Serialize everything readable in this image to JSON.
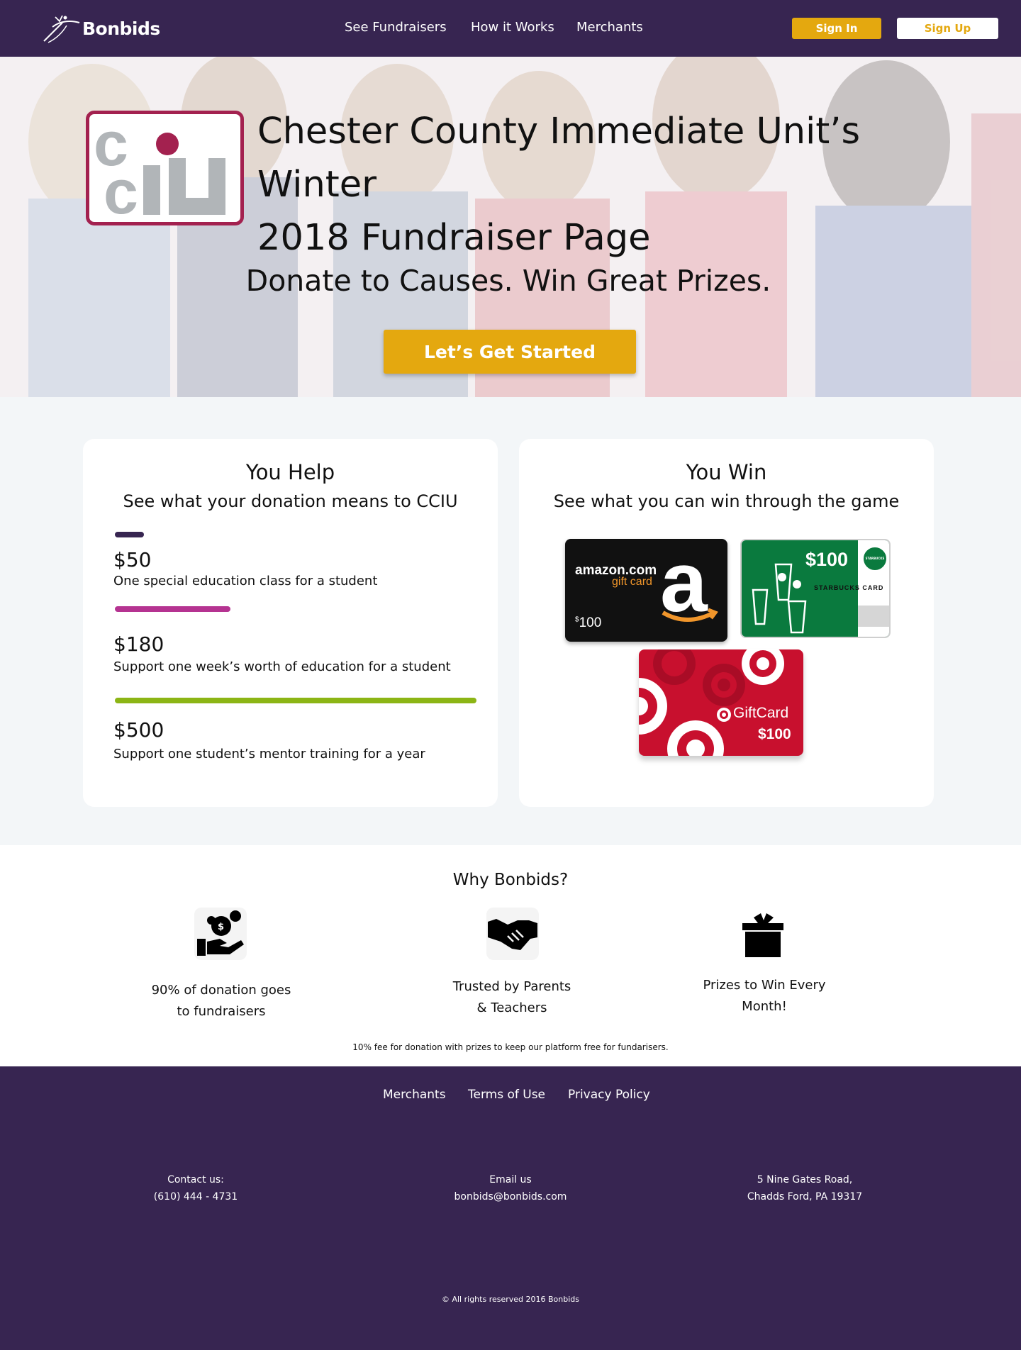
{
  "nav": {
    "brand": "Bonbids",
    "links": [
      "See Fundraisers",
      "How it Works",
      "Merchants"
    ],
    "sign_in": "Sign In",
    "sign_up": "Sign Up"
  },
  "hero": {
    "logo_text": "cciu",
    "title_line1": "Chester County Immediate Unit’s Winter",
    "title_line2": "2018 Fundraiser Page",
    "tagline": "Donate to Causes. Win Great Prizes.",
    "cta": "Let’s Get Started"
  },
  "help": {
    "title": "You Help",
    "subtitle": "See what your donation means to CCIU",
    "tiers": [
      {
        "amount": "$50",
        "description": "One special education class for a student",
        "level": 0.08,
        "color": "#372551"
      },
      {
        "amount": "$180",
        "description": "Support one week’s worth of education for a student",
        "level": 0.32,
        "color": "#b53391"
      },
      {
        "amount": "$500",
        "description": "Support one student’s mentor training for a year",
        "level": 1.0,
        "color": "#8cb515"
      }
    ]
  },
  "win": {
    "title": "You Win",
    "subtitle": "See what you can win through the game",
    "prizes": {
      "amazon": {
        "brand": "amazon.com",
        "kind": "gift card",
        "value": "100",
        "currency": "$"
      },
      "starbucks": {
        "value": "$100",
        "label": "STARBUCKS CARD",
        "seal": "STARBUCKS COFFEE"
      },
      "target": {
        "label": "GiftCard",
        "value": "$100"
      }
    }
  },
  "why": {
    "title": "Why Bonbids?",
    "items": [
      {
        "line1": "90% of donation goes",
        "line2": "to fundraisers",
        "icon": "donation-hand-icon"
      },
      {
        "line1": "Trusted by Parents",
        "line2": "& Teachers",
        "icon": "handshake-icon"
      },
      {
        "line1": "Prizes to Win Every",
        "line2": "Month!",
        "icon": "gift-box-icon"
      }
    ],
    "note": "10% fee for donation with prizes to keep our platform free for fundarisers."
  },
  "footer": {
    "links": [
      "Merchants",
      "Terms of Use",
      "Privacy Policy"
    ],
    "contact_label": "Contact us:",
    "contact_phone": "(610) 444 - 4731",
    "email_label": "Email us",
    "email": "bonbids@bonbids.com",
    "address_line1": "5 Nine Gates Road,",
    "address_line2": "Chadds Ford, PA 19317",
    "copyright": "© All rights reserved 2016 Bonbids"
  },
  "colors": {
    "nav_bg": "#372551",
    "accent_gold": "#e4a80f",
    "cciu_red": "#a3214f",
    "section_bg": "#f3f6f8"
  }
}
